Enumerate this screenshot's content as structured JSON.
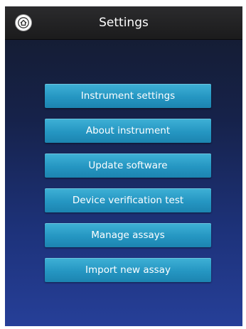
{
  "header": {
    "title": "Settings",
    "home_icon": "home-icon"
  },
  "menu": {
    "items": [
      {
        "label": "Instrument settings"
      },
      {
        "label": "About instrument"
      },
      {
        "label": "Update software"
      },
      {
        "label": "Device verification test"
      },
      {
        "label": "Manage assays"
      },
      {
        "label": "Import new assay"
      }
    ]
  },
  "colors": {
    "header_background": "#1f1f20",
    "background_top": "#141b2c",
    "background_bottom": "#263f98",
    "button": "#2596c2",
    "text": "#ffffff"
  }
}
